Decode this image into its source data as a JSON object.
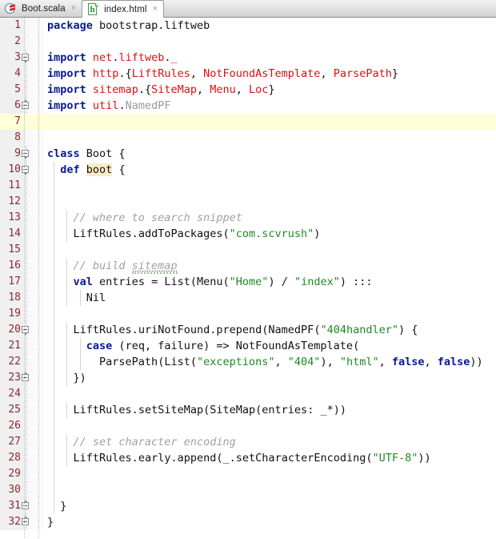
{
  "window": {
    "app": "code-editor",
    "colors": {
      "keyword": "#0a1a8f",
      "string": "#1d8a24",
      "class": "#dc1010",
      "comment": "#a0a0a0",
      "gutter_number": "#8b2b2b",
      "current_line_highlight": "#feffd6",
      "identifier_highlight": "#faebc8",
      "background": "#ffffff",
      "tabbar_background": "#e4e4e4"
    }
  },
  "tabbar": {
    "tabs": [
      {
        "label": "Boot.scala",
        "icon": "scala-file-icon",
        "close": "×",
        "active": false
      },
      {
        "label": "index.html",
        "icon": "html-file-icon",
        "close": "×",
        "active": true
      }
    ]
  },
  "editor": {
    "filename": "Boot.scala",
    "language": "scala",
    "current_line": 7,
    "highlighted_identifier": "boot",
    "misspelled_word": "sitemap",
    "total_lines": 32,
    "lines": [
      {
        "n": 1,
        "text": "package bootstrap.liftweb"
      },
      {
        "n": 2,
        "text": ""
      },
      {
        "n": 3,
        "text": "import net.liftweb._"
      },
      {
        "n": 4,
        "text": "import http.{LiftRules, NotFoundAsTemplate, ParsePath}"
      },
      {
        "n": 5,
        "text": "import sitemap.{SiteMap, Menu, Loc}"
      },
      {
        "n": 6,
        "text": "import util.NamedPF"
      },
      {
        "n": 7,
        "text": ""
      },
      {
        "n": 8,
        "text": ""
      },
      {
        "n": 9,
        "text": "class Boot {"
      },
      {
        "n": 10,
        "text": "  def boot {"
      },
      {
        "n": 11,
        "text": ""
      },
      {
        "n": 12,
        "text": ""
      },
      {
        "n": 13,
        "text": "    // where to search snippet"
      },
      {
        "n": 14,
        "text": "    LiftRules.addToPackages(\"com.scvrush\")"
      },
      {
        "n": 15,
        "text": ""
      },
      {
        "n": 16,
        "text": "    // build sitemap"
      },
      {
        "n": 17,
        "text": "    val entries = List(Menu(\"Home\") / \"index\") :::"
      },
      {
        "n": 18,
        "text": "      Nil"
      },
      {
        "n": 19,
        "text": ""
      },
      {
        "n": 20,
        "text": "    LiftRules.uriNotFound.prepend(NamedPF(\"404handler\") {"
      },
      {
        "n": 21,
        "text": "      case (req, failure) => NotFoundAsTemplate("
      },
      {
        "n": 22,
        "text": "        ParsePath(List(\"exceptions\", \"404\"), \"html\", false, false))"
      },
      {
        "n": 23,
        "text": "    })"
      },
      {
        "n": 24,
        "text": ""
      },
      {
        "n": 25,
        "text": "    LiftRules.setSiteMap(SiteMap(entries: _*))"
      },
      {
        "n": 26,
        "text": ""
      },
      {
        "n": 27,
        "text": "    // set character encoding"
      },
      {
        "n": 28,
        "text": "    LiftRules.early.append(_.setCharacterEncoding(\"UTF-8\"))"
      },
      {
        "n": 29,
        "text": ""
      },
      {
        "n": 30,
        "text": ""
      },
      {
        "n": 31,
        "text": "  }"
      },
      {
        "n": 32,
        "text": "}"
      }
    ],
    "fold_markers": [
      {
        "line": 3,
        "type": "start"
      },
      {
        "line": 6,
        "type": "end"
      },
      {
        "line": 9,
        "type": "start"
      },
      {
        "line": 10,
        "type": "start"
      },
      {
        "line": 20,
        "type": "start"
      },
      {
        "line": 23,
        "type": "end"
      },
      {
        "line": 31,
        "type": "end"
      },
      {
        "line": 32,
        "type": "end"
      }
    ]
  }
}
